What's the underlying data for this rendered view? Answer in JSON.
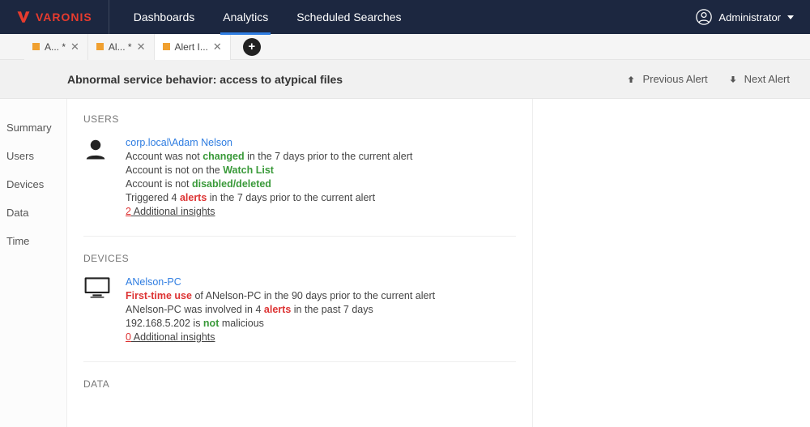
{
  "brand": "VARONIS",
  "nav": {
    "dashboards": "Dashboards",
    "analytics": "Analytics",
    "scheduled": "Scheduled Searches"
  },
  "user_menu": {
    "name": "Administrator"
  },
  "tabs": {
    "t0": "A... *",
    "t1": "Al... *",
    "t2": "Alert I..."
  },
  "alert": {
    "title": "Abnormal service behavior: access to atypical files",
    "prev": "Previous Alert",
    "next": "Next Alert"
  },
  "sidebar": {
    "summary": "Summary",
    "users": "Users",
    "devices": "Devices",
    "data": "Data",
    "time": "Time"
  },
  "sections": {
    "users": {
      "title": "USERS",
      "principal": "corp.local\\Adam Nelson",
      "l1a": "Account was not ",
      "l1b": "changed",
      "l1c": " in the 7 days prior to the current alert",
      "l2a": "Account is not on the ",
      "l2b": "Watch List",
      "l3a": "Account is not ",
      "l3b": "disabled/deleted",
      "l4a": "Triggered 4 ",
      "l4b": "alerts",
      "l4c": " in the 7 days prior to the current alert",
      "insights_count": "2",
      "insights_label": " Additional insights"
    },
    "devices": {
      "title": "DEVICES",
      "principal": "ANelson-PC",
      "l1a": "First-time use",
      "l1b": " of ANelson-PC in the 90 days prior to the current alert",
      "l2a": "ANelson-PC was involved in 4 ",
      "l2b": "alerts",
      "l2c": " in the past 7 days",
      "l3a": "192.168.5.202 is ",
      "l3b": "not",
      "l3c": " malicious",
      "insights_count": "0",
      "insights_label": " Additional insights"
    },
    "data": {
      "title": "DATA"
    }
  }
}
